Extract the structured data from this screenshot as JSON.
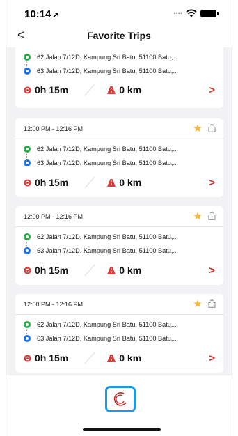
{
  "status": {
    "time": "10:14"
  },
  "nav": {
    "title": "Favorite Trips",
    "back_label": "<"
  },
  "colors": {
    "accent_red": "#d22222",
    "star": "#f6b93b",
    "origin": "#2aa84a",
    "destination": "#1d6fe8",
    "loader_border": "#1a9be6"
  },
  "trips": [
    {
      "time_range": "",
      "origin": "62 Jalan 7/12D, Kampung Sri Batu, 51100 Batu,...",
      "destination": "63 Jalan 7/12D, Kampung Sri Batu, 51100 Batu,...",
      "duration": "0h 15m",
      "distance": "0 km",
      "favorite": true
    },
    {
      "time_range": "12:00 PM - 12:16 PM",
      "origin": "62 Jalan 7/12D, Kampung Sri Batu, 51100 Batu,...",
      "destination": "63 Jalan 7/12D, Kampung Sri Batu, 51100 Batu,...",
      "duration": "0h 15m",
      "distance": "0 km",
      "favorite": true
    },
    {
      "time_range": "12:00 PM - 12:16 PM",
      "origin": "62 Jalan 7/12D, Kampung Sri Batu, 51100 Batu,...",
      "destination": "63 Jalan 7/12D, Kampung Sri Batu, 51100 Batu,...",
      "duration": "0h 15m",
      "distance": "0 km",
      "favorite": true
    },
    {
      "time_range": "12:00 PM - 12:16 PM",
      "origin": "62 Jalan 7/12D, Kampung Sri Batu, 51100 Batu,...",
      "destination": "63 Jalan 7/12D, Kampung Sri Batu, 51100 Batu,...",
      "duration": "0h 15m",
      "distance": "0 km",
      "favorite": true
    }
  ],
  "icons": {
    "back": "chevron-left-icon",
    "star": "star-icon",
    "share": "share-icon",
    "duration": "clock-icon",
    "distance": "road-icon",
    "open": "chevron-right-icon",
    "loader": "spinner-icon"
  }
}
